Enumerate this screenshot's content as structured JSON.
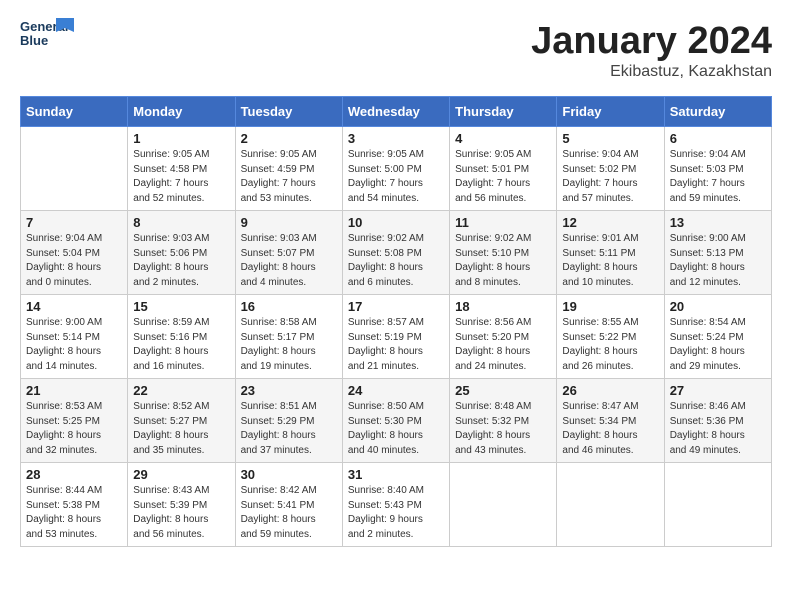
{
  "header": {
    "logo_line1": "General",
    "logo_line2": "Blue",
    "month": "January 2024",
    "location": "Ekibastuz, Kazakhstan"
  },
  "weekdays": [
    "Sunday",
    "Monday",
    "Tuesday",
    "Wednesday",
    "Thursday",
    "Friday",
    "Saturday"
  ],
  "weeks": [
    [
      {
        "day": "",
        "info": ""
      },
      {
        "day": "1",
        "info": "Sunrise: 9:05 AM\nSunset: 4:58 PM\nDaylight: 7 hours\nand 52 minutes."
      },
      {
        "day": "2",
        "info": "Sunrise: 9:05 AM\nSunset: 4:59 PM\nDaylight: 7 hours\nand 53 minutes."
      },
      {
        "day": "3",
        "info": "Sunrise: 9:05 AM\nSunset: 5:00 PM\nDaylight: 7 hours\nand 54 minutes."
      },
      {
        "day": "4",
        "info": "Sunrise: 9:05 AM\nSunset: 5:01 PM\nDaylight: 7 hours\nand 56 minutes."
      },
      {
        "day": "5",
        "info": "Sunrise: 9:04 AM\nSunset: 5:02 PM\nDaylight: 7 hours\nand 57 minutes."
      },
      {
        "day": "6",
        "info": "Sunrise: 9:04 AM\nSunset: 5:03 PM\nDaylight: 7 hours\nand 59 minutes."
      }
    ],
    [
      {
        "day": "7",
        "info": "Sunrise: 9:04 AM\nSunset: 5:04 PM\nDaylight: 8 hours\nand 0 minutes."
      },
      {
        "day": "8",
        "info": "Sunrise: 9:03 AM\nSunset: 5:06 PM\nDaylight: 8 hours\nand 2 minutes."
      },
      {
        "day": "9",
        "info": "Sunrise: 9:03 AM\nSunset: 5:07 PM\nDaylight: 8 hours\nand 4 minutes."
      },
      {
        "day": "10",
        "info": "Sunrise: 9:02 AM\nSunset: 5:08 PM\nDaylight: 8 hours\nand 6 minutes."
      },
      {
        "day": "11",
        "info": "Sunrise: 9:02 AM\nSunset: 5:10 PM\nDaylight: 8 hours\nand 8 minutes."
      },
      {
        "day": "12",
        "info": "Sunrise: 9:01 AM\nSunset: 5:11 PM\nDaylight: 8 hours\nand 10 minutes."
      },
      {
        "day": "13",
        "info": "Sunrise: 9:00 AM\nSunset: 5:13 PM\nDaylight: 8 hours\nand 12 minutes."
      }
    ],
    [
      {
        "day": "14",
        "info": "Sunrise: 9:00 AM\nSunset: 5:14 PM\nDaylight: 8 hours\nand 14 minutes."
      },
      {
        "day": "15",
        "info": "Sunrise: 8:59 AM\nSunset: 5:16 PM\nDaylight: 8 hours\nand 16 minutes."
      },
      {
        "day": "16",
        "info": "Sunrise: 8:58 AM\nSunset: 5:17 PM\nDaylight: 8 hours\nand 19 minutes."
      },
      {
        "day": "17",
        "info": "Sunrise: 8:57 AM\nSunset: 5:19 PM\nDaylight: 8 hours\nand 21 minutes."
      },
      {
        "day": "18",
        "info": "Sunrise: 8:56 AM\nSunset: 5:20 PM\nDaylight: 8 hours\nand 24 minutes."
      },
      {
        "day": "19",
        "info": "Sunrise: 8:55 AM\nSunset: 5:22 PM\nDaylight: 8 hours\nand 26 minutes."
      },
      {
        "day": "20",
        "info": "Sunrise: 8:54 AM\nSunset: 5:24 PM\nDaylight: 8 hours\nand 29 minutes."
      }
    ],
    [
      {
        "day": "21",
        "info": "Sunrise: 8:53 AM\nSunset: 5:25 PM\nDaylight: 8 hours\nand 32 minutes."
      },
      {
        "day": "22",
        "info": "Sunrise: 8:52 AM\nSunset: 5:27 PM\nDaylight: 8 hours\nand 35 minutes."
      },
      {
        "day": "23",
        "info": "Sunrise: 8:51 AM\nSunset: 5:29 PM\nDaylight: 8 hours\nand 37 minutes."
      },
      {
        "day": "24",
        "info": "Sunrise: 8:50 AM\nSunset: 5:30 PM\nDaylight: 8 hours\nand 40 minutes."
      },
      {
        "day": "25",
        "info": "Sunrise: 8:48 AM\nSunset: 5:32 PM\nDaylight: 8 hours\nand 43 minutes."
      },
      {
        "day": "26",
        "info": "Sunrise: 8:47 AM\nSunset: 5:34 PM\nDaylight: 8 hours\nand 46 minutes."
      },
      {
        "day": "27",
        "info": "Sunrise: 8:46 AM\nSunset: 5:36 PM\nDaylight: 8 hours\nand 49 minutes."
      }
    ],
    [
      {
        "day": "28",
        "info": "Sunrise: 8:44 AM\nSunset: 5:38 PM\nDaylight: 8 hours\nand 53 minutes."
      },
      {
        "day": "29",
        "info": "Sunrise: 8:43 AM\nSunset: 5:39 PM\nDaylight: 8 hours\nand 56 minutes."
      },
      {
        "day": "30",
        "info": "Sunrise: 8:42 AM\nSunset: 5:41 PM\nDaylight: 8 hours\nand 59 minutes."
      },
      {
        "day": "31",
        "info": "Sunrise: 8:40 AM\nSunset: 5:43 PM\nDaylight: 9 hours\nand 2 minutes."
      },
      {
        "day": "",
        "info": ""
      },
      {
        "day": "",
        "info": ""
      },
      {
        "day": "",
        "info": ""
      }
    ]
  ]
}
